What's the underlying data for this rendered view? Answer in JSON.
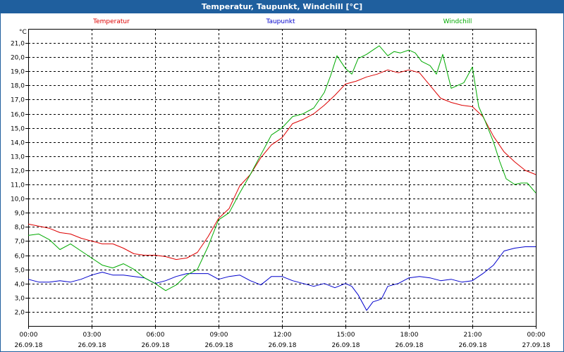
{
  "window": {
    "title": "Temperatur, Taupunkt, Windchill [°C]"
  },
  "chart_data": {
    "type": "line",
    "title": "Temperatur, Taupunkt, Windchill [°C]",
    "ylabel": "°C",
    "ylim": [
      1.0,
      22.0
    ],
    "yticks": [
      2.0,
      3.0,
      4.0,
      5.0,
      6.0,
      7.0,
      8.0,
      9.0,
      10.0,
      11.0,
      12.0,
      13.0,
      14.0,
      15.0,
      16.0,
      17.0,
      18.0,
      19.0,
      20.0,
      21.0
    ],
    "ytick_labels": [
      "2,0",
      "3,0",
      "4,0",
      "5,0",
      "6,0",
      "7,0",
      "8,0",
      "9,0",
      "10,0",
      "11,0",
      "12,0",
      "13,0",
      "14,0",
      "15,0",
      "16,0",
      "17,0",
      "18,0",
      "19,0",
      "20,0",
      "21,0"
    ],
    "xlim": [
      0,
      24
    ],
    "xticks": [
      0,
      3,
      6,
      9,
      12,
      15,
      18,
      21,
      24
    ],
    "xtick_times": [
      "00:00",
      "03:00",
      "06:00",
      "09:00",
      "12:00",
      "15:00",
      "18:00",
      "21:00",
      "00:00"
    ],
    "xtick_dates": [
      "26.09.18",
      "26.09.18",
      "26.09.18",
      "26.09.18",
      "26.09.18",
      "26.09.18",
      "26.09.18",
      "26.09.18",
      "27.09.18"
    ],
    "grid": true,
    "series": [
      {
        "name": "Temperatur",
        "color": "#dd0000",
        "x": [
          0,
          1,
          1.5,
          2,
          2.5,
          3,
          3.5,
          4,
          4.5,
          5,
          5.5,
          6,
          6.5,
          7,
          7.5,
          8,
          8.5,
          9,
          9.5,
          10,
          10.5,
          11,
          11.5,
          12,
          12.5,
          13,
          13.5,
          14,
          14.5,
          15,
          15.5,
          16,
          16.5,
          17,
          17.5,
          18,
          18.5,
          19,
          19.5,
          20,
          20.5,
          21,
          21.5,
          22,
          22.5,
          23,
          23.5,
          24
        ],
        "y": [
          8.2,
          7.9,
          7.6,
          7.5,
          7.2,
          7.0,
          6.8,
          6.8,
          6.5,
          6.1,
          6.0,
          6.0,
          5.9,
          5.7,
          5.8,
          6.2,
          7.3,
          8.6,
          9.3,
          10.9,
          11.7,
          12.9,
          13.8,
          14.3,
          15.3,
          15.6,
          16.0,
          16.6,
          17.3,
          18.1,
          18.3,
          18.6,
          18.8,
          19.1,
          18.9,
          19.1,
          18.9,
          18.0,
          17.1,
          16.8,
          16.6,
          16.5,
          15.8,
          14.4,
          13.3,
          12.6,
          12.0,
          11.7
        ]
      },
      {
        "name": "Taupunkt",
        "color": "#0000cc",
        "x": [
          0,
          0.5,
          1,
          1.5,
          2,
          2.5,
          3,
          3.5,
          4,
          4.5,
          5,
          5.5,
          6,
          6.5,
          7,
          7.5,
          8,
          8.5,
          9,
          9.5,
          10,
          10.5,
          11,
          11.5,
          12,
          12.5,
          13,
          13.5,
          14,
          14.5,
          15,
          15.3,
          15.6,
          16,
          16.3,
          16.7,
          17,
          17.5,
          18,
          18.5,
          19,
          19.5,
          20,
          20.5,
          21,
          21.5,
          22,
          22.5,
          23,
          23.5,
          24
        ],
        "y": [
          4.3,
          4.1,
          4.1,
          4.2,
          4.1,
          4.3,
          4.6,
          4.8,
          4.6,
          4.6,
          4.5,
          4.4,
          4.0,
          4.2,
          4.5,
          4.7,
          4.7,
          4.7,
          4.3,
          4.5,
          4.6,
          4.2,
          3.9,
          4.5,
          4.5,
          4.2,
          4.0,
          3.8,
          4.0,
          3.7,
          4.0,
          3.8,
          3.2,
          2.1,
          2.7,
          2.9,
          3.8,
          4.0,
          4.4,
          4.5,
          4.4,
          4.2,
          4.3,
          4.1,
          4.2,
          4.7,
          5.3,
          6.3,
          6.5,
          6.6,
          6.6
        ]
      },
      {
        "name": "Windchill",
        "color": "#00aa00",
        "x": [
          0,
          0.5,
          1,
          1.5,
          2,
          2.5,
          3,
          3.5,
          4,
          4.5,
          5,
          5.5,
          6,
          6.5,
          7,
          7.5,
          8,
          8.5,
          9,
          9.5,
          10,
          10.5,
          11,
          11.5,
          12,
          12.5,
          13,
          13.5,
          14,
          14.3,
          14.6,
          15,
          15.3,
          15.6,
          16,
          16.3,
          16.6,
          17,
          17.3,
          17.6,
          18,
          18.3,
          18.6,
          19,
          19.3,
          19.6,
          20,
          20.3,
          20.6,
          21,
          21.3,
          21.6,
          22,
          22.3,
          22.6,
          23,
          23.3,
          23.6,
          24
        ],
        "y": [
          7.4,
          7.5,
          7.1,
          6.4,
          6.8,
          6.3,
          5.8,
          5.3,
          5.1,
          5.4,
          5.0,
          4.4,
          4.0,
          3.5,
          3.9,
          4.6,
          5.0,
          6.6,
          8.5,
          9.0,
          10.4,
          11.7,
          13.1,
          14.5,
          15.0,
          15.8,
          16.0,
          16.4,
          17.5,
          18.7,
          20.1,
          19.2,
          18.8,
          19.9,
          20.2,
          20.5,
          20.8,
          20.1,
          20.4,
          20.3,
          20.5,
          20.3,
          19.7,
          19.4,
          18.8,
          20.2,
          17.8,
          18.0,
          18.2,
          19.3,
          16.5,
          15.5,
          14.0,
          12.6,
          11.4,
          11.0,
          11.1,
          11.1,
          10.4
        ]
      }
    ]
  }
}
